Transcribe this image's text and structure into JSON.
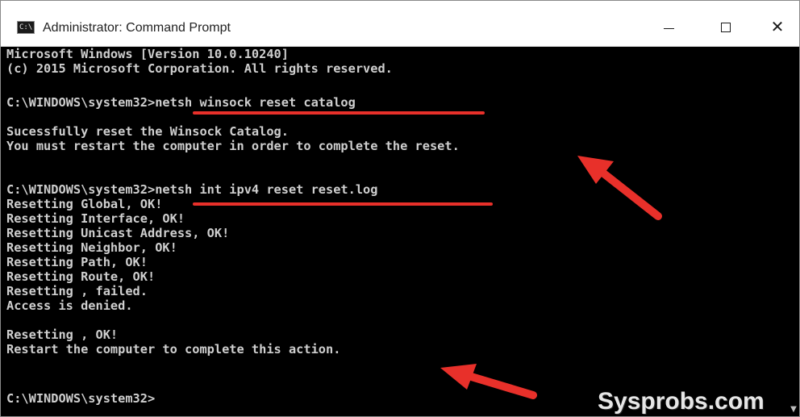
{
  "window": {
    "title": "Administrator: Command Prompt",
    "icon": "cmd-icon",
    "icon_glyph": "C:\\",
    "controls": {
      "minimize": "minimize-icon",
      "maximize": "maximize-icon",
      "close": "close-icon",
      "close_glyph": "✕"
    }
  },
  "console": {
    "lines": [
      "Microsoft Windows [Version 10.0.10240]",
      "(c) 2015 Microsoft Corporation. All rights reserved.",
      "",
      "C:\\WINDOWS\\system32>netsh winsock reset catalog",
      "",
      "Sucessfully reset the Winsock Catalog.",
      "You must restart the computer in order to complete the reset.",
      "",
      "",
      "C:\\WINDOWS\\system32>netsh int ipv4 reset reset.log",
      "Resetting Global, OK!",
      "Resetting Interface, OK!",
      "Resetting Unicast Address, OK!",
      "Resetting Neighbor, OK!",
      "Resetting Path, OK!",
      "Resetting Route, OK!",
      "Resetting , failed.",
      "Access is denied.",
      "",
      "Resetting , OK!",
      "Restart the computer to complete this action.",
      "",
      "",
      "C:\\WINDOWS\\system32>"
    ]
  },
  "watermark": "Sysprobs.com",
  "colors": {
    "console_bg": "#000000",
    "console_text": "#cfcfcf",
    "annotation_red": "#e8302a",
    "titlebar_bg": "#ffffff"
  }
}
